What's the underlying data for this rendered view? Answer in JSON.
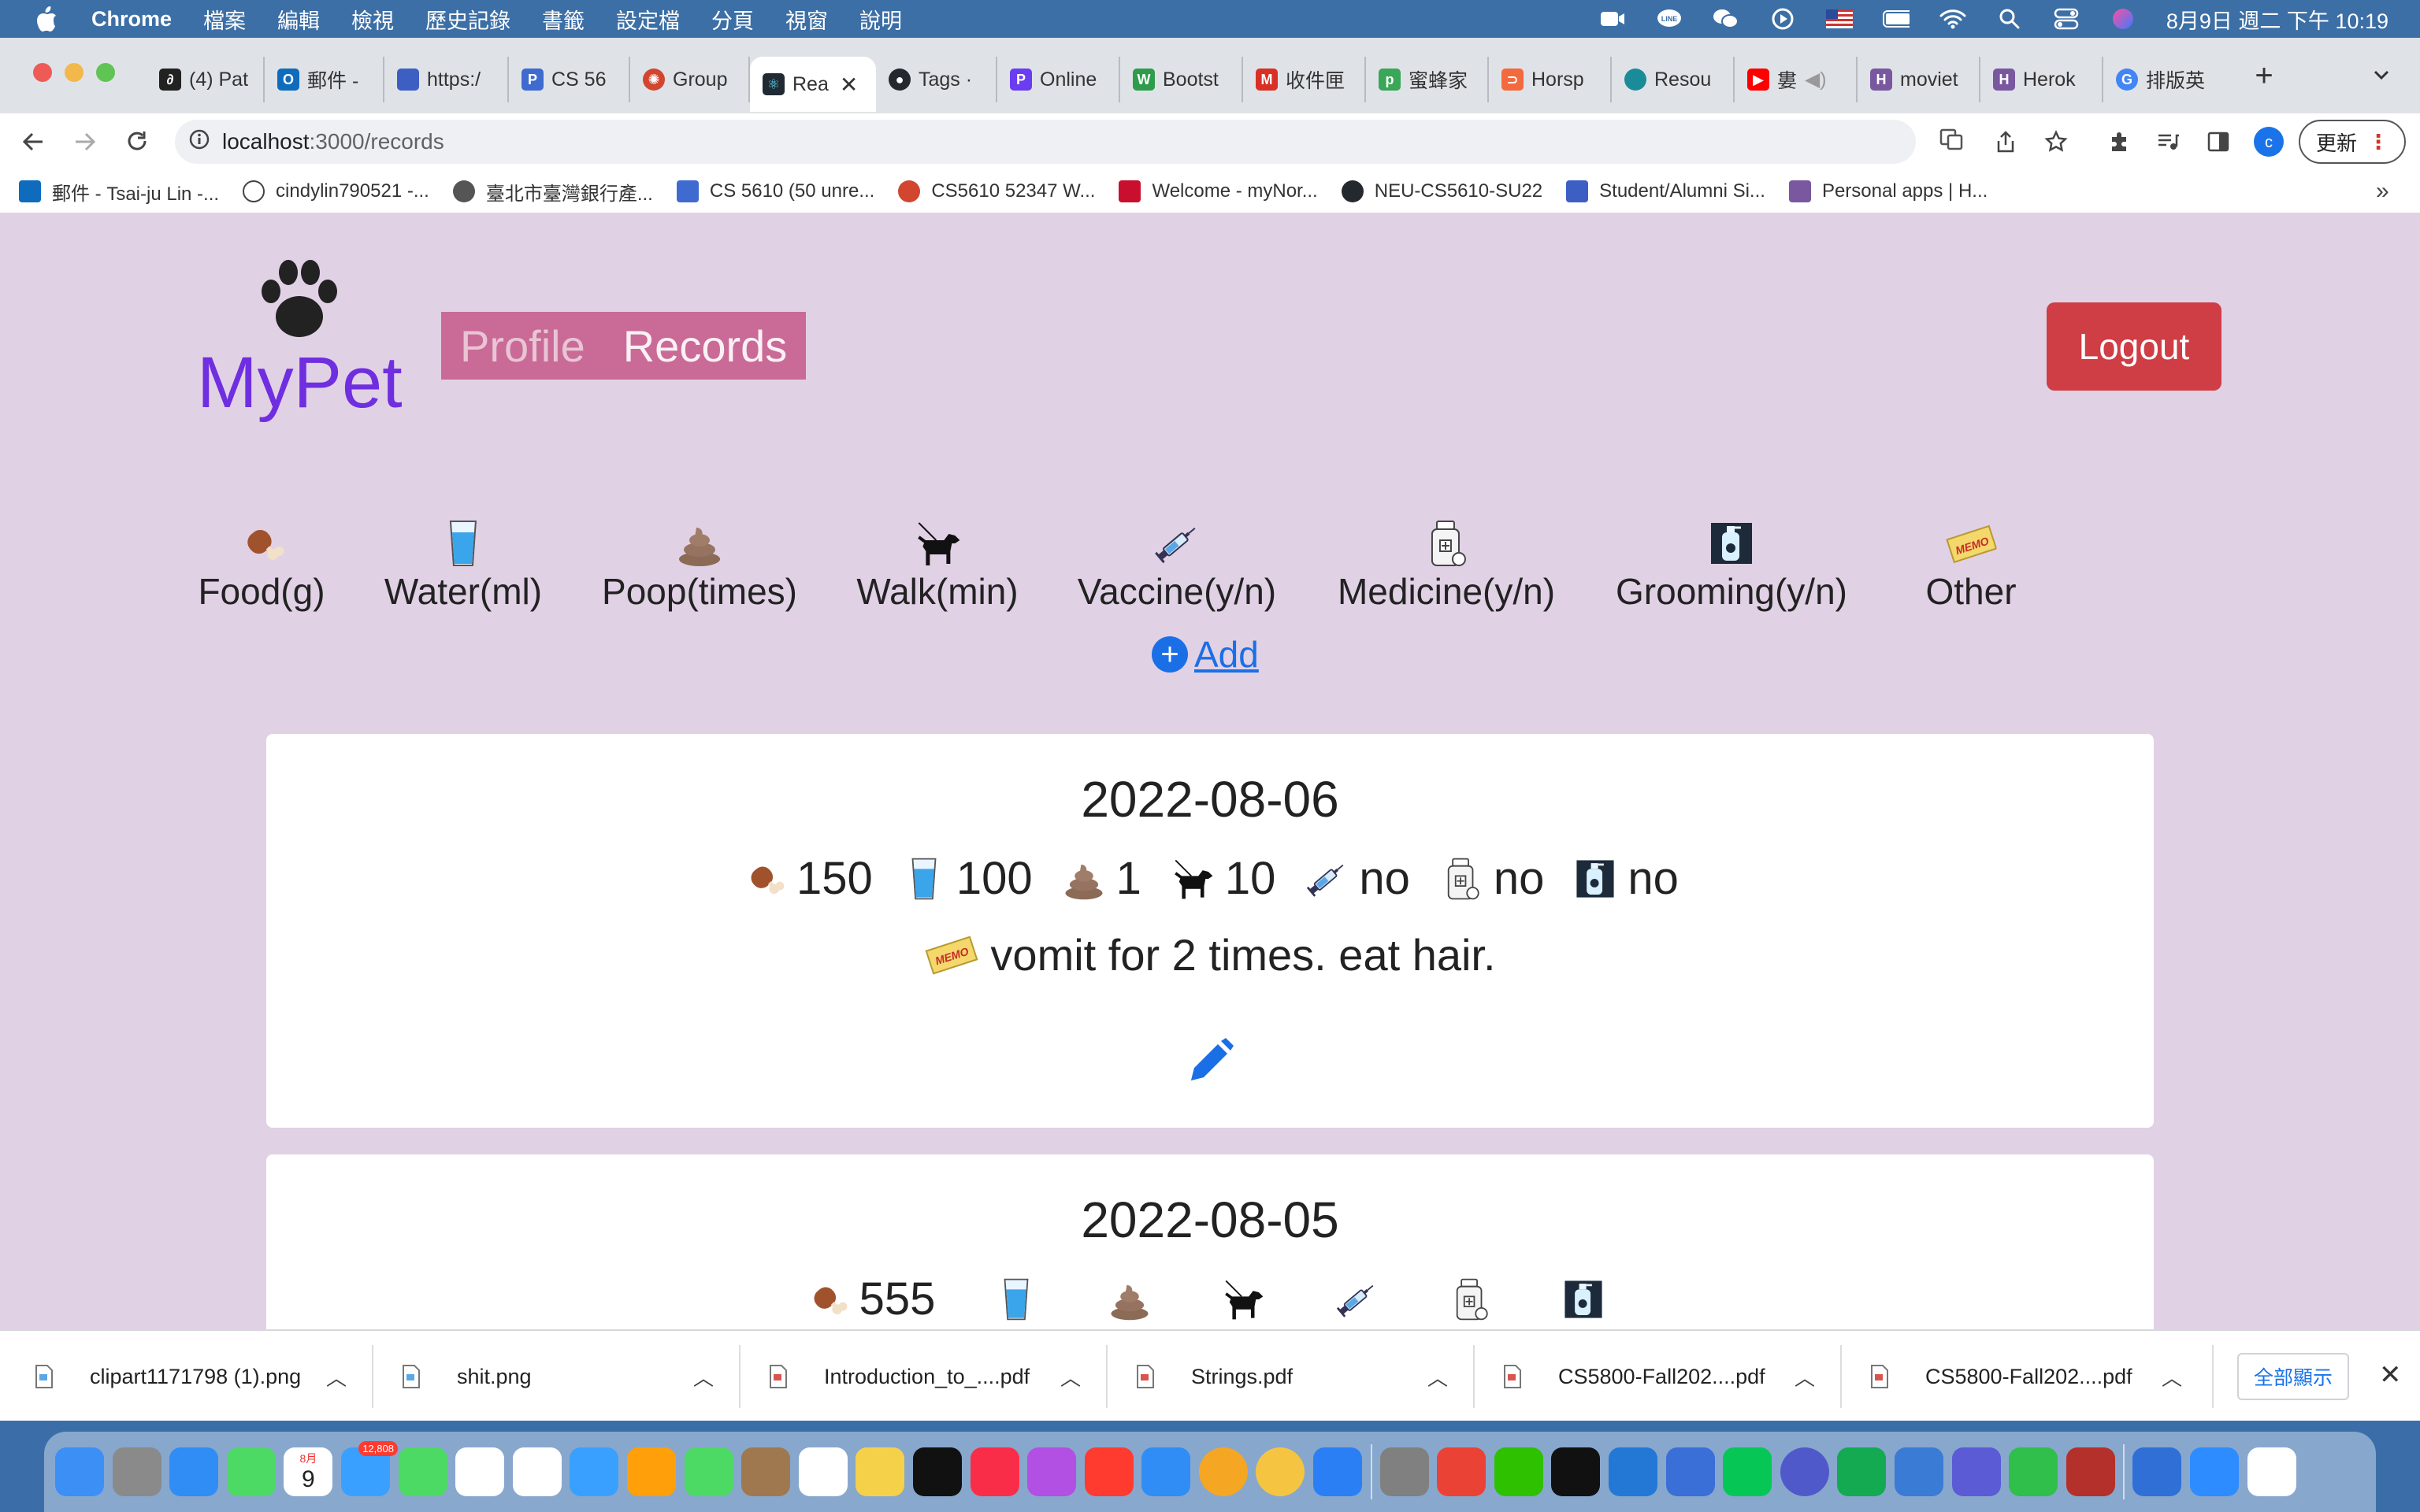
{
  "menubar": {
    "app": "Chrome",
    "items": [
      "檔案",
      "編輯",
      "檢視",
      "歷史記錄",
      "書籤",
      "設定檔",
      "分頁",
      "視窗",
      "說明"
    ],
    "clock": "8月9日 週二 下午 10:19"
  },
  "tabs": [
    {
      "label": "(4) Pat",
      "color": "#222222"
    },
    {
      "label": "郵件 -",
      "color": "#0f6cbd"
    },
    {
      "label": "https:/",
      "color": "#3d5fc4"
    },
    {
      "label": "CS 56",
      "color": "#3f6bd0"
    },
    {
      "label": "Group",
      "color": "#d2452f"
    },
    {
      "label": "Rea",
      "color": "#1f2a33"
    },
    {
      "label": "Tags ·",
      "color": "#24292f"
    },
    {
      "label": "Online",
      "color": "#6a3df0"
    },
    {
      "label": "Bootst",
      "color": "#2e9c4a"
    },
    {
      "label": "收件匣",
      "color": "#d93025"
    },
    {
      "label": "蜜蜂家",
      "color": "#3aa657"
    },
    {
      "label": "Horsp",
      "color": "#f26a3d"
    },
    {
      "label": "Resou",
      "color": "#1a8c99"
    },
    {
      "label": "婁",
      "color": "#ff0000"
    },
    {
      "label": "moviet",
      "color": "#79589f"
    },
    {
      "label": "Herok",
      "color": "#79589f"
    },
    {
      "label": "排版英",
      "color": "#4285f4"
    }
  ],
  "active_tab_index": 5,
  "new_tab_label": "+",
  "address": {
    "host": "localhost",
    "path": ":3000/records"
  },
  "update_button": "更新",
  "profile_initial": "c",
  "bookmarks": [
    {
      "label": "郵件 - Tsai-ju Lin -...",
      "color": "#0f6cbd"
    },
    {
      "label": "cindylin790521 -...",
      "color": "#444444"
    },
    {
      "label": "臺北市臺灣銀行產...",
      "color": "#555555"
    },
    {
      "label": "CS 5610 (50 unre...",
      "color": "#3f6bd0"
    },
    {
      "label": "CS5610 52347 W...",
      "color": "#d2452f"
    },
    {
      "label": "Welcome - myNor...",
      "color": "#c8102e"
    },
    {
      "label": "NEU-CS5610-SU22",
      "color": "#24292f"
    },
    {
      "label": "Student/Alumni Si...",
      "color": "#3d5fc4"
    },
    {
      "label": "Personal apps | H...",
      "color": "#79589f"
    }
  ],
  "bookmarks_more": "»",
  "app": {
    "brand": "MyPet",
    "nav": [
      "Profile",
      "Records"
    ],
    "logout": "Logout",
    "legend": [
      {
        "label": "Food(g)",
        "icon": "meat-icon"
      },
      {
        "label": "Water(ml)",
        "icon": "water-glass-icon"
      },
      {
        "label": "Poop(times)",
        "icon": "poop-icon"
      },
      {
        "label": "Walk(min)",
        "icon": "dog-icon"
      },
      {
        "label": "Vaccine(y/n)",
        "icon": "syringe-icon"
      },
      {
        "label": "Medicine(y/n)",
        "icon": "medicine-bottle-icon"
      },
      {
        "label": "Grooming(y/n)",
        "icon": "shampoo-bottle-icon"
      },
      {
        "label": "Other",
        "icon": "memo-icon"
      }
    ],
    "add_label": " Add",
    "records": [
      {
        "date": "2022-08-06",
        "food": "150",
        "water": "100",
        "poop": "1",
        "walk": "10",
        "vaccine": "no",
        "medicine": "no",
        "grooming": "no",
        "other": "vomit for 2 times. eat hair."
      },
      {
        "date": "2022-08-05",
        "food": "555",
        "water": "",
        "poop": "",
        "walk": "",
        "vaccine": "",
        "medicine": "",
        "grooming": "",
        "other": ""
      }
    ]
  },
  "downloads": {
    "items": [
      "clipart1171798 (1).png",
      "shit.png",
      "Introduction_to_....pdf",
      "Strings.pdf",
      "CS5800-Fall202....pdf",
      "CS5800-Fall202....pdf"
    ],
    "show_all": "全部顯示",
    "close": "✕"
  },
  "dock": {
    "calendar_month": "8月",
    "calendar_day": "9",
    "mail_badge": "12,808",
    "icon_colors": [
      "#3c8ff5",
      "#8a8a8a",
      "#2f8df5",
      "#4cd964",
      "#4cd964",
      "#ffffff",
      "#ffffff",
      "#3aa0ff",
      "#ff9f0a",
      "#4cd964",
      "#a07850",
      "#ffffff",
      "#f5d14a",
      "#111111",
      "#fa2d48",
      "#b150e2",
      "#ff3b30",
      "#2f8df5",
      "#f5a623",
      "#f5c542",
      "#2b7ff5",
      "#808080",
      "#ea4335",
      "#2dc100",
      "#111111",
      "#2378d6",
      "#3a6fd8",
      "#06c755",
      "#5059c9",
      "#13aa52",
      "#3a7bd5",
      "#5b5bd6",
      "#2fbf4a",
      "#b3312a",
      "#2f6fd6",
      "#2d8cff",
      "#ffffff",
      "#c8d4e6",
      "#333333",
      "#444444",
      "#cfd6de"
    ]
  }
}
